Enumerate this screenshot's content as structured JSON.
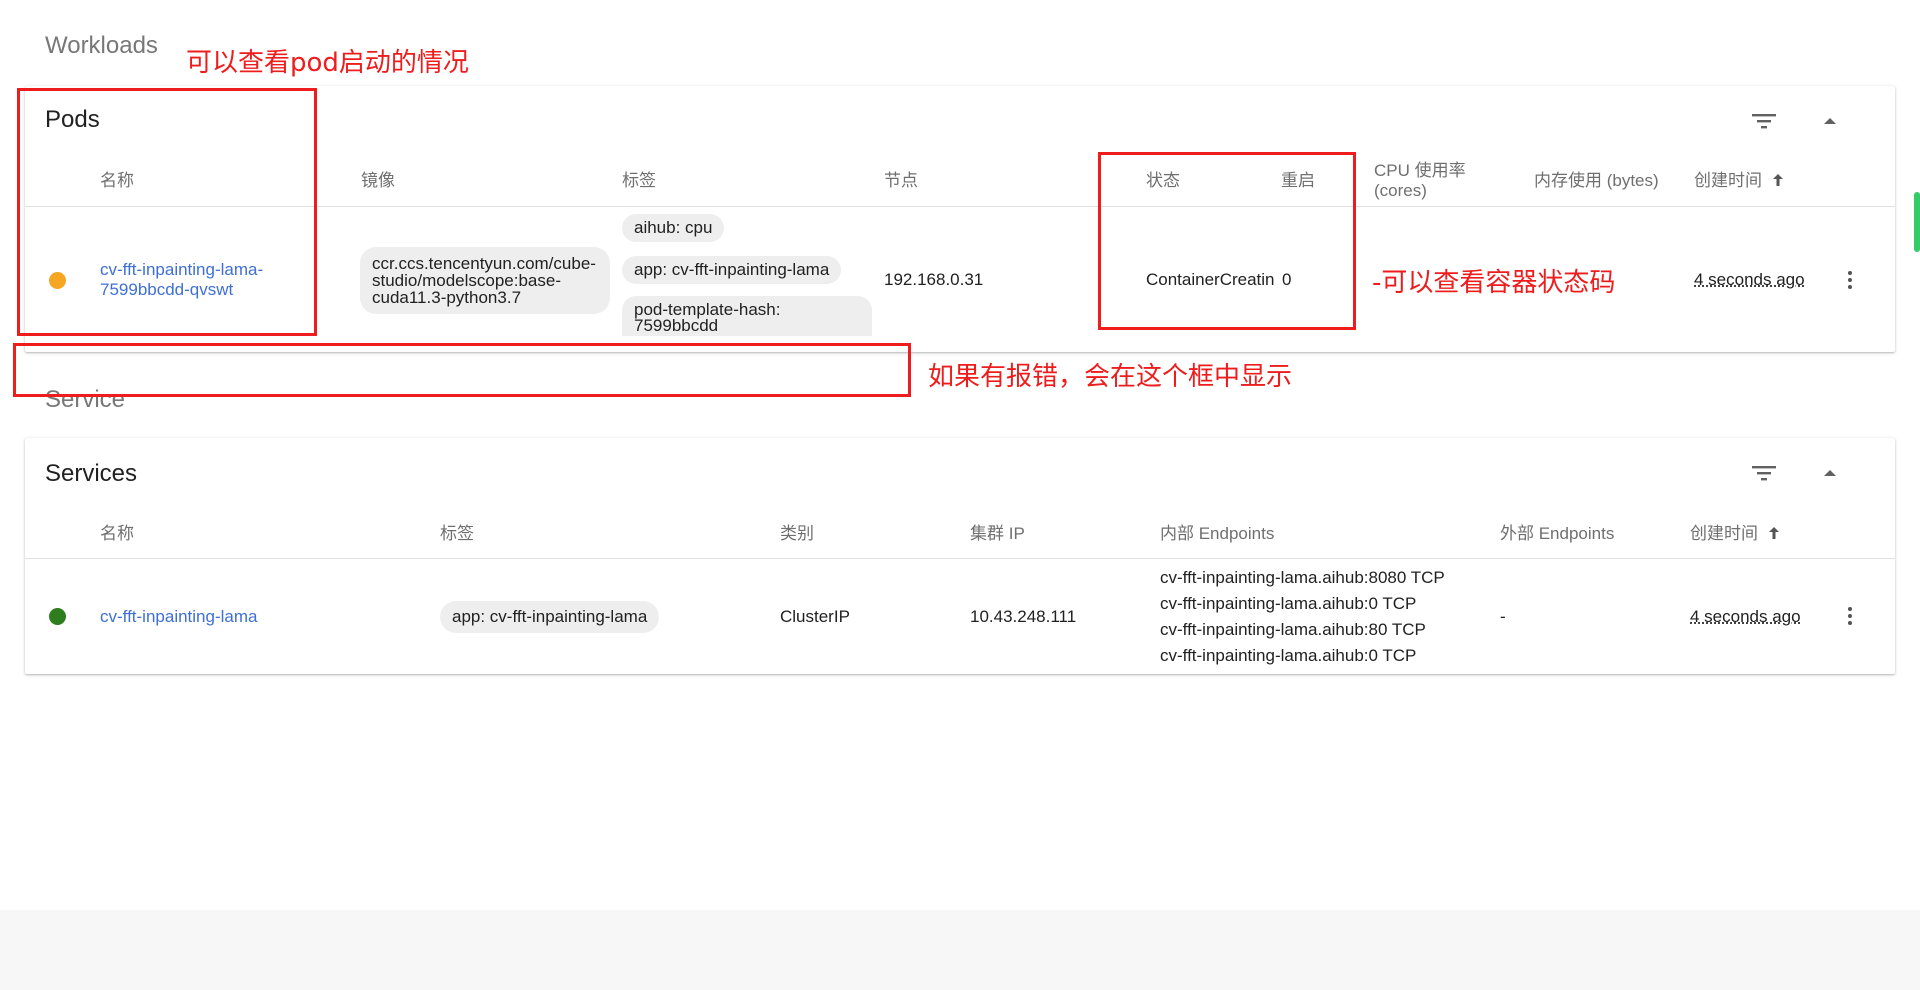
{
  "workloads": {
    "title": "Workloads"
  },
  "pods": {
    "title": "Pods",
    "headers": {
      "name": "名称",
      "image": "镜像",
      "labels": "标签",
      "node": "节点",
      "status": "状态",
      "restarts": "重启",
      "cpu": "CPU 使用率 (cores)",
      "memory": "内存使用 (bytes)",
      "created": "创建时间"
    },
    "row": {
      "status_color": "#f5a623",
      "name": "cv-fft-inpainting-lama-7599bbcdd-qvswt",
      "image": "ccr.ccs.tencentyun.com/cube-studio/modelscope:base-cuda11.3-python3.7",
      "labels": [
        "aihub: cpu",
        "app: cv-fft-inpainting-lama",
        "pod-template-hash: 7599bbcdd"
      ],
      "node": "192.168.0.31",
      "status": "ContainerCreatin",
      "restarts": "0",
      "age": "4 seconds ago"
    }
  },
  "service_section": {
    "title": "Service"
  },
  "services": {
    "title": "Services",
    "headers": {
      "name": "名称",
      "labels": "标签",
      "type": "类别",
      "cluster_ip": "集群 IP",
      "internal": "内部 Endpoints",
      "external": "外部 Endpoints",
      "created": "创建时间"
    },
    "row": {
      "status_color": "#2e7d1f",
      "name": "cv-fft-inpainting-lama",
      "label": "app: cv-fft-inpainting-lama",
      "type": "ClusterIP",
      "cluster_ip": "10.43.248.111",
      "endpoints": [
        "cv-fft-inpainting-lama.aihub:8080 TCP",
        "cv-fft-inpainting-lama.aihub:0 TCP",
        "cv-fft-inpainting-lama.aihub:80 TCP",
        "cv-fft-inpainting-lama.aihub:0 TCP"
      ],
      "external": "-",
      "age": "4 seconds ago"
    }
  },
  "annotations": {
    "pod_start": "可以查看pod启动的情况",
    "status_code": "-可以查看容器状态码",
    "error_box": "如果有报错，会在这个框中显示"
  },
  "colors": {
    "annotation_red": "#ee1c1c",
    "link_blue": "#3f6fd6"
  },
  "icons": {
    "filter": "filter-icon",
    "collapse": "expand-less-icon",
    "sort": "arrow-up-icon",
    "more": "more-vert-icon"
  }
}
